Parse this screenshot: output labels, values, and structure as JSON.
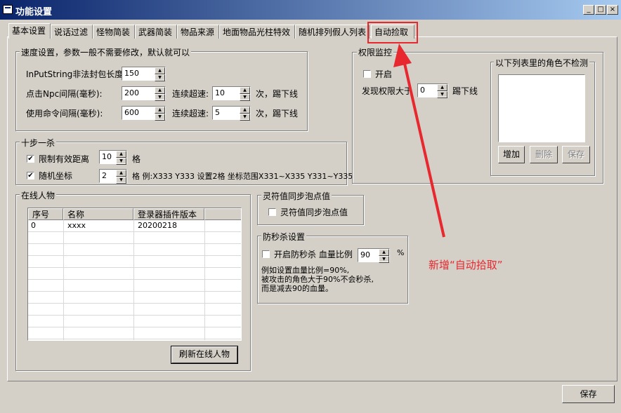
{
  "window": {
    "title": "功能设置",
    "controls": [
      "_",
      "□",
      "×"
    ]
  },
  "tabs": [
    {
      "label": "基本设置",
      "active": true
    },
    {
      "label": "说话过滤",
      "active": false
    },
    {
      "label": "怪物简装",
      "active": false
    },
    {
      "label": "武器简装",
      "active": false
    },
    {
      "label": "物品来源",
      "active": false
    },
    {
      "label": "地面物品光柱特效",
      "active": false
    },
    {
      "label": "随机排列假人列表",
      "active": false
    },
    {
      "label": "自动捡取",
      "active": false
    }
  ],
  "speed_group": {
    "title": "速度设置，参数一般不需要修改，默认就可以",
    "rows": [
      {
        "label": "InPutString非法封包长度:",
        "value": "150"
      },
      {
        "label": "点击Npc间隔(毫秒):",
        "value": "200",
        "combo_label": "连续超速:",
        "combo_value": "10",
        "suffix": "次，踢下线"
      },
      {
        "label": "使用命令间隔(毫秒):",
        "value": "600",
        "combo_label": "连续超速:",
        "combo_value": "5",
        "suffix": "次，踢下线"
      }
    ]
  },
  "step_group": {
    "title": "十步一杀",
    "limit_label": "限制有效距离",
    "limit_checked": true,
    "limit_value": "10",
    "limit_unit": "格",
    "random_label": "随机坐标",
    "random_checked": true,
    "random_value": "2",
    "random_note": "格 例:X333 Y333 设置2格 坐标范围X331~X335 Y331~Y335"
  },
  "online_group": {
    "title": "在线人物",
    "columns": [
      "序号",
      "名称",
      "登录器插件版本"
    ],
    "rows": [
      [
        "0",
        "xxxx",
        "20200218"
      ]
    ],
    "refresh_button": "刷新在线人物"
  },
  "lingfu_group": {
    "title": "灵符值同步泡点值",
    "checkbox_label": "灵符值同步泡点值",
    "checked": false
  },
  "antikill_group": {
    "title": "防秒杀设置",
    "checkbox_label": "开启防秒杀 血量比例",
    "checked": false,
    "value": "90",
    "unit": "%",
    "note1": "例如设置血量比例=90%,",
    "note2": "被攻击的角色大于90%不会秒杀,",
    "note3": "而是减去90的血量。"
  },
  "permission_group": {
    "title": "权限监控",
    "enable_label": "开启",
    "enabled": false,
    "detect_label": "发现权限大于",
    "detect_value": "0",
    "detect_suffix": "踢下线",
    "exclude_group": {
      "title": "以下列表里的角色不检测",
      "add_button": "增加",
      "delete_button": "删除",
      "save_button": "保存"
    }
  },
  "save_button": "保存",
  "annotation": {
    "text": "新增“自动拾取”",
    "color": "#e8282f"
  }
}
